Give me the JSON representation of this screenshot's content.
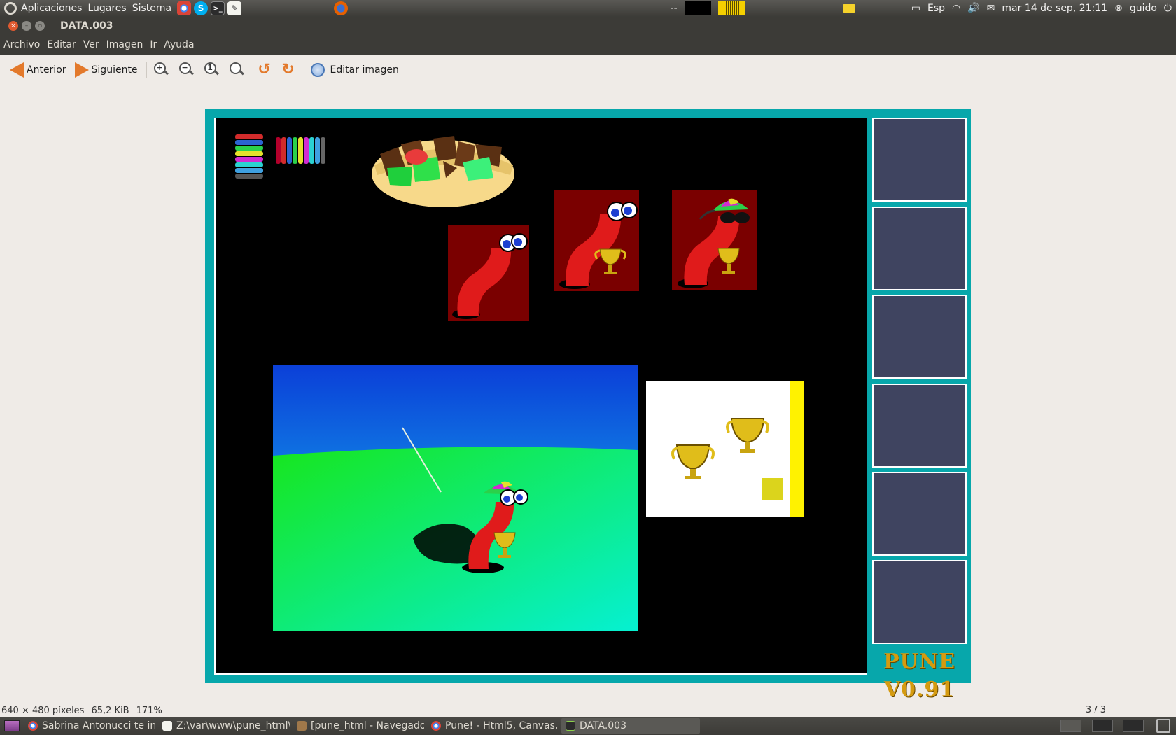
{
  "top_panel": {
    "menus": [
      "Aplicaciones",
      "Lugares",
      "Sistema"
    ],
    "separator_text": "--",
    "keyboard_layout": "Esp",
    "clock": "mar 14 de sep, 21:11",
    "user": "guido"
  },
  "window": {
    "title": "DATA.003"
  },
  "menu_bar": [
    "Archivo",
    "Editar",
    "Ver",
    "Imagen",
    "Ir",
    "Ayuda"
  ],
  "toolbar": {
    "prev_label": "Anterior",
    "next_label": "Siguiente",
    "edit_label": "Editar imagen"
  },
  "game": {
    "version_label": "PUNE V0.91",
    "accent_color": "#07a7ab",
    "slot_color": "#3f4460"
  },
  "status_bar": {
    "dimensions": "640 × 480 píxeles",
    "file_size": "65,2 KiB",
    "zoom": "171%",
    "page": "3 / 3"
  },
  "taskbar": [
    {
      "label": "Sabrina Antonucci te in...",
      "icon": "chrome-icon"
    },
    {
      "label": "Z:\\var\\www\\pune_html\\...",
      "icon": "text-editor-icon"
    },
    {
      "label": "[pune_html - Navegado...",
      "icon": "file-browser-icon"
    },
    {
      "label": "Pune! - Html5, Canvas, ...",
      "icon": "chrome-icon"
    },
    {
      "label": "DATA.003",
      "icon": "image-viewer-icon"
    }
  ]
}
